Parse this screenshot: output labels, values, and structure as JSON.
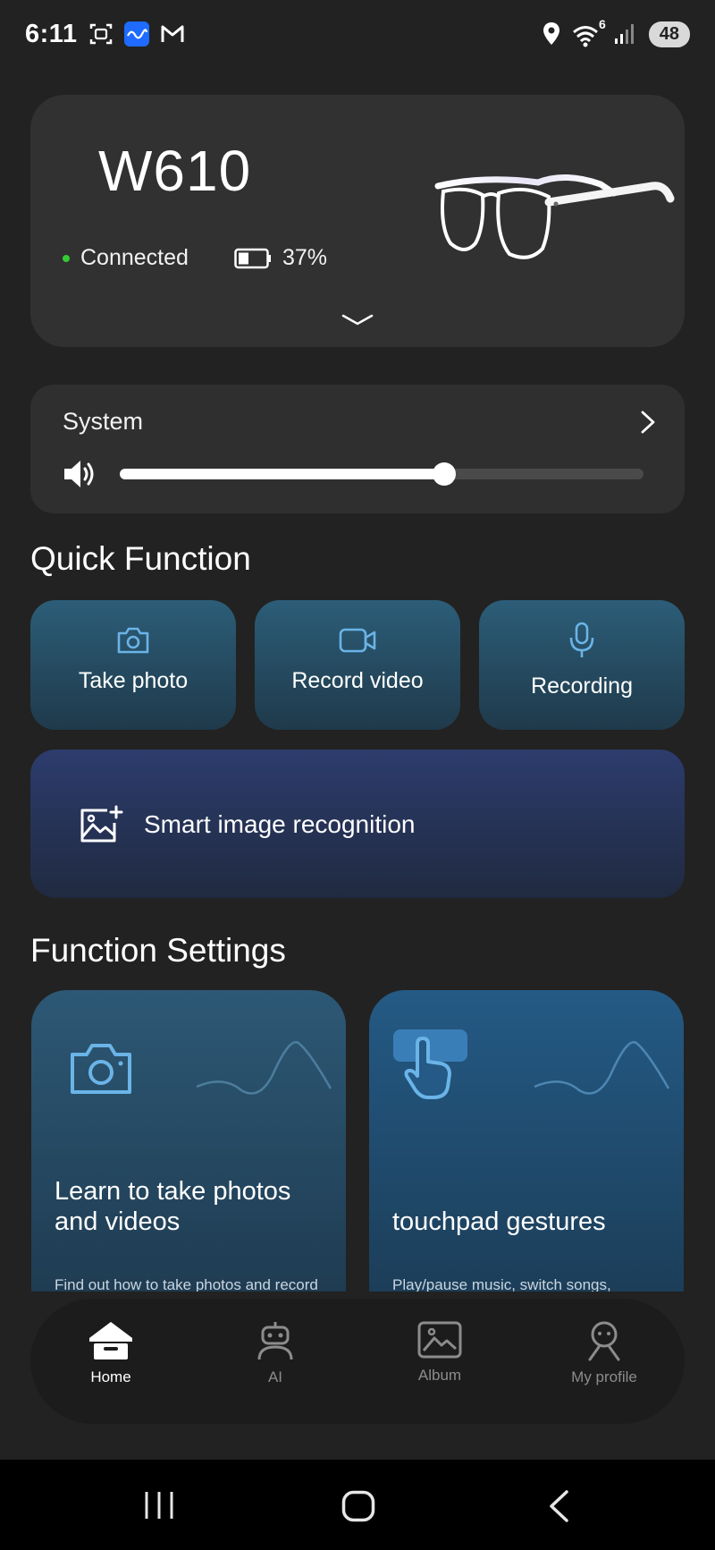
{
  "status_bar": {
    "time": "6:11",
    "notification_icons": [
      "screenshot-icon",
      "app-wave-icon",
      "gmail-icon"
    ],
    "network_superscript": "6",
    "battery": "48"
  },
  "device": {
    "name": "W610",
    "connection_status": "Connected",
    "connection_color": "#33cc33",
    "battery_percent": "37%",
    "battery_level": 0.37
  },
  "system_volume": {
    "label": "System",
    "level": 0.62
  },
  "quick_function": {
    "title": "Quick Function",
    "buttons": [
      {
        "label": "Take photo",
        "icon": "camera-icon"
      },
      {
        "label": "Record video",
        "icon": "video-icon"
      },
      {
        "label": "Recording",
        "icon": "microphone-icon"
      }
    ],
    "smart_recognition": {
      "label": "Smart image recognition",
      "icon": "image-add-icon"
    }
  },
  "function_settings": {
    "title": "Function Settings",
    "cards": [
      {
        "title": "Learn to take photos and videos",
        "description": "Find out how to take photos and record",
        "icon": "camera-icon"
      },
      {
        "title": "touchpad gestures",
        "description": "Play/pause music, switch songs,",
        "icon": "tap-hand-icon"
      }
    ]
  },
  "bottom_nav": {
    "items": [
      {
        "label": "Home",
        "icon": "home-icon",
        "active": true
      },
      {
        "label": "AI",
        "icon": "robot-icon",
        "active": false
      },
      {
        "label": "Album",
        "icon": "image-icon",
        "active": false
      },
      {
        "label": "My profile",
        "icon": "profile-icon",
        "active": false
      }
    ]
  },
  "colors": {
    "background": "#222222",
    "card": "#313131",
    "accent_blue": "#6ab4e8"
  }
}
